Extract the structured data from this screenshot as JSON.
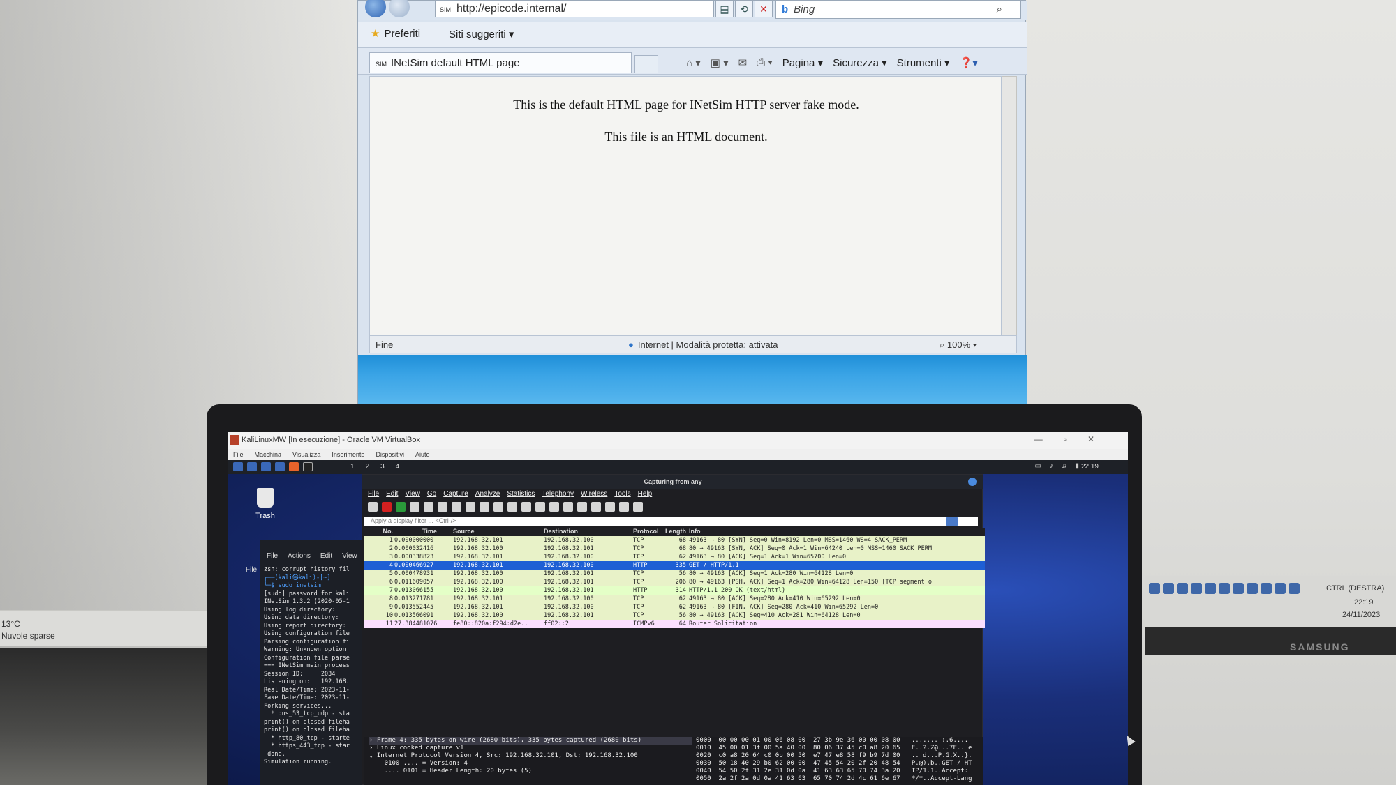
{
  "ie": {
    "url": "http://epicode.internal/",
    "url_icon": "SIM",
    "search_engine": "Bing",
    "favorites_label": "Preferiti",
    "suggested_sites_label": "Siti suggeriti",
    "tab_title": "INetSim default HTML page",
    "tab_icon": "SIM",
    "cmd_page": "Pagina",
    "cmd_security": "Sicurezza",
    "cmd_tools": "Strumenti",
    "content_line1": "This is the default HTML page for INetSim HTTP server fake mode.",
    "content_line2": "This file is an HTML document.",
    "status_done": "Fine",
    "status_zone": "Internet | Modalità protetta: attivata",
    "zoom": "100%"
  },
  "host": {
    "temperature": "13°C",
    "weather": "Nuvole sparse",
    "ctrl_label": "CTRL (DESTRA)",
    "time": "22:19",
    "date": "24/11/2023",
    "brand": "SAMSUNG"
  },
  "vbox": {
    "title": "KaliLinuxMW [In esecuzione] - Oracle VM VirtualBox",
    "menu": [
      "File",
      "Macchina",
      "Visualizza",
      "Inserimento",
      "Dispositivi",
      "Aiuto"
    ]
  },
  "kali": {
    "workspaces": [
      "1",
      "2",
      "3",
      "4"
    ],
    "clock": "22:19",
    "trash_label": "Trash",
    "file_label": "File"
  },
  "terminal": {
    "menu": [
      "File",
      "Actions",
      "Edit",
      "View"
    ],
    "lines": [
      "zsh: corrupt history fil",
      "┌──(kali㉿kali)-[~]",
      "└─$ sudo inetsim",
      "[sudo] password for kali",
      "INetSim 1.3.2 (2020-05-1",
      "Using log directory:",
      "Using data directory:",
      "Using report directory:",
      "Using configuration file",
      "Parsing configuration fi",
      "Warning: Unknown option",
      "Configuration file parse",
      "=== INetSim main process",
      "Session ID:     2034",
      "Listening on:   192.168.",
      "Real Date/Time: 2023-11-",
      "Fake Date/Time: 2023-11-",
      "Forking services...",
      "  * dns_53_tcp_udp - sta",
      "print() on closed fileha",
      "print() on closed fileha",
      "  * http_80_tcp - starte",
      "  * https_443_tcp - star",
      " done.",
      "Simulation running."
    ]
  },
  "wireshark": {
    "title": "Capturing from any",
    "menu": [
      "File",
      "Edit",
      "View",
      "Go",
      "Capture",
      "Analyze",
      "Statistics",
      "Telephony",
      "Wireless",
      "Tools",
      "Help"
    ],
    "filter_placeholder": "Apply a display filter ... <Ctrl-/>",
    "columns": [
      "No.",
      "Time",
      "Source",
      "Destination",
      "Protocol",
      "Length",
      "Info"
    ],
    "packets": [
      {
        "no": "1",
        "time": "0.000000000",
        "src": "192.168.32.101",
        "dst": "192.168.32.100",
        "proto": "TCP",
        "len": "68",
        "info": "49163 → 80 [SYN] Seq=0 Win=8192 Len=0 MSS=1460 WS=4 SACK_PERM",
        "kind": "tcp"
      },
      {
        "no": "2",
        "time": "0.000032416",
        "src": "192.168.32.100",
        "dst": "192.168.32.101",
        "proto": "TCP",
        "len": "68",
        "info": "80 → 49163 [SYN, ACK] Seq=0 Ack=1 Win=64240 Len=0 MSS=1460 SACK_PERM",
        "kind": "tcp"
      },
      {
        "no": "3",
        "time": "0.000338823",
        "src": "192.168.32.101",
        "dst": "192.168.32.100",
        "proto": "TCP",
        "len": "62",
        "info": "49163 → 80 [ACK] Seq=1 Ack=1 Win=65700 Len=0",
        "kind": "tcp"
      },
      {
        "no": "4",
        "time": "0.000466927",
        "src": "192.168.32.101",
        "dst": "192.168.32.100",
        "proto": "HTTP",
        "len": "335",
        "info": "GET / HTTP/1.1",
        "kind": "sel"
      },
      {
        "no": "5",
        "time": "0.000478931",
        "src": "192.168.32.100",
        "dst": "192.168.32.101",
        "proto": "TCP",
        "len": "56",
        "info": "80 → 49163 [ACK] Seq=1 Ack=280 Win=64128 Len=0",
        "kind": "tcp"
      },
      {
        "no": "6",
        "time": "0.011609057",
        "src": "192.168.32.100",
        "dst": "192.168.32.101",
        "proto": "TCP",
        "len": "206",
        "info": "80 → 49163 [PSH, ACK] Seq=1 Ack=280 Win=64128 Len=150 [TCP segment o",
        "kind": "tcp"
      },
      {
        "no": "7",
        "time": "0.013066155",
        "src": "192.168.32.100",
        "dst": "192.168.32.101",
        "proto": "HTTP",
        "len": "314",
        "info": "HTTP/1.1 200 OK  (text/html)",
        "kind": "http"
      },
      {
        "no": "8",
        "time": "0.013271781",
        "src": "192.168.32.101",
        "dst": "192.168.32.100",
        "proto": "TCP",
        "len": "62",
        "info": "49163 → 80 [ACK] Seq=280 Ack=410 Win=65292 Len=0",
        "kind": "tcp"
      },
      {
        "no": "9",
        "time": "0.013552445",
        "src": "192.168.32.101",
        "dst": "192.168.32.100",
        "proto": "TCP",
        "len": "62",
        "info": "49163 → 80 [FIN, ACK] Seq=280 Ack=410 Win=65292 Len=0",
        "kind": "tcp"
      },
      {
        "no": "10",
        "time": "0.013566091",
        "src": "192.168.32.100",
        "dst": "192.168.32.101",
        "proto": "TCP",
        "len": "56",
        "info": "80 → 49163 [ACK] Seq=410 Ack=281 Win=64128 Len=0",
        "kind": "tcp"
      },
      {
        "no": "11",
        "time": "27.384481076",
        "src": "fe80::820a:f294:d2e..",
        "dst": "ff02::2",
        "proto": "ICMPv6",
        "len": "64",
        "info": "Router Solicitation",
        "kind": "icmpv6"
      }
    ],
    "details": [
      "› Frame 4: 335 bytes on wire (2680 bits), 335 bytes captured (2680 bits)",
      "› Linux cooked capture v1",
      "⌄ Internet Protocol Version 4, Src: 192.168.32.101, Dst: 192.168.32.100",
      "    0100 .... = Version: 4",
      "    .... 0101 = Header Length: 20 bytes (5)"
    ],
    "hex": [
      "0000  00 00 00 01 00 06 08 00  27 3b 9e 36 00 00 08 00   .......';.6....",
      "0010  45 00 01 3f 00 5a 40 00  80 06 37 45 c0 a8 20 65   E..?.Z@...7E.. e",
      "0020  c0 a8 20 64 c0 0b 00 50  e7 47 e8 58 f9 b9 7d 00   .. d...P.G.X..}.",
      "0030  50 18 40 29 b0 62 00 00  47 45 54 20 2f 20 48 54   P.@).b..GET / HT",
      "0040  54 50 2f 31 2e 31 0d 0a  41 63 63 65 70 74 3a 20   TP/1.1..Accept: ",
      "0050  2a 2f 2a 0d 0a 41 63 63  65 70 74 2d 4c 61 6e 67   */*..Accept-Lang"
    ]
  }
}
